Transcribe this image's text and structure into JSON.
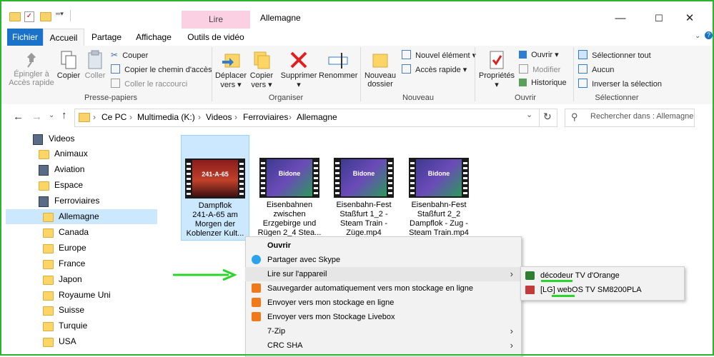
{
  "window": {
    "title": "Allemagne",
    "context_tab": "Lire",
    "controls": [
      "—",
      "☐",
      "✕"
    ]
  },
  "ribbon_tabs": [
    "Fichier",
    "Accueil",
    "Partage",
    "Affichage",
    "Outils de vidéo"
  ],
  "ribbon": {
    "presse": {
      "group": "Presse-papiers",
      "pin": [
        "Épingler à",
        "Accès rapide"
      ],
      "copy": "Copier",
      "paste": "Coller",
      "cut": "Couper",
      "copy_path": "Copier le chemin d'accès",
      "paste_shortcut": "Coller le raccourci"
    },
    "organiser": {
      "group": "Organiser",
      "move": [
        "Déplacer",
        "vers"
      ],
      "copy_to": [
        "Copier",
        "vers"
      ],
      "delete": "Supprimer",
      "rename": "Renommer"
    },
    "nouveau": {
      "group": "Nouveau",
      "new_folder": [
        "Nouveau",
        "dossier"
      ],
      "new_item": "Nouvel élément",
      "easy_access": "Accès rapide"
    },
    "ouvrir": {
      "group": "Ouvrir",
      "properties": "Propriétés",
      "open": "Ouvrir",
      "edit": "Modifier",
      "history": "Historique"
    },
    "selection": {
      "group": "Sélectionner",
      "select_all": "Sélectionner tout",
      "select_none": "Aucun",
      "invert": "Inverser la sélection"
    }
  },
  "address": {
    "crumbs": [
      "Ce PC",
      "Multimedia (K:)",
      "Videos",
      "Ferroviaires",
      "Allemagne"
    ],
    "search_placeholder": "Rechercher dans : Allemagne"
  },
  "tree": [
    {
      "label": "Videos",
      "type": "film"
    },
    {
      "label": "Animaux",
      "type": "folder"
    },
    {
      "label": "Aviation",
      "type": "film"
    },
    {
      "label": "Espace",
      "type": "folder"
    },
    {
      "label": "Ferroviaires",
      "type": "film"
    },
    {
      "label": "Allemagne",
      "type": "folder",
      "selected": true
    },
    {
      "label": "Canada",
      "type": "folder"
    },
    {
      "label": "Europe",
      "type": "folder"
    },
    {
      "label": "France",
      "type": "folder"
    },
    {
      "label": "Japon",
      "type": "folder"
    },
    {
      "label": "Royaume Uni",
      "type": "folder"
    },
    {
      "label": "Suisse",
      "type": "folder"
    },
    {
      "label": "Turquie",
      "type": "folder"
    },
    {
      "label": "USA",
      "type": "folder"
    }
  ],
  "files": [
    {
      "lines": [
        "Dampflok",
        "241-A-65 am",
        "Morgen der",
        "Koblenzer Kult..."
      ],
      "overlay": "241-A-65",
      "selected": true
    },
    {
      "lines": [
        "Eisenbahnen",
        "zwischen",
        "Erzgebirge und",
        "Rügen 2_4 Stea..."
      ],
      "overlay": "Bidone"
    },
    {
      "lines": [
        "Eisenbahn-Fest",
        "Staßfurt 1_2 -",
        "Steam Train -",
        "Züge.mp4"
      ],
      "overlay": "Bidone"
    },
    {
      "lines": [
        "Eisenbahn-Fest",
        "Staßfurt 2_2",
        "Dampflok - Zug -",
        "Steam Train.mp4"
      ],
      "overlay": "Bidone"
    }
  ],
  "context_menu": [
    {
      "label": "Ouvrir",
      "bold": true
    },
    {
      "label": "Partager avec Skype",
      "icon": "skype-icon"
    },
    {
      "label": "Lire sur l'appareil",
      "submenu": true,
      "highlight": true
    },
    {
      "label": "Sauvegarder automatiquement vers mon stockage en ligne",
      "icon": "cloud-backup-icon"
    },
    {
      "label": "Envoyer vers mon stockage en ligne",
      "icon": "cloud-upload-icon"
    },
    {
      "label": "Envoyer vers mon Stockage Livebox",
      "icon": "livebox-icon"
    },
    {
      "label": "7-Zip",
      "submenu": true
    },
    {
      "label": "CRC SHA",
      "submenu": true
    }
  ],
  "submenu": [
    {
      "label": "décodeur TV d'Orange",
      "icon": "decoder-icon"
    },
    {
      "label": "[LG] webOS TV SM8200PLA",
      "icon": "tv-icon"
    }
  ],
  "colors": {
    "accent": "#1a73c8",
    "annotation": "#2bd42b",
    "selection": "#cce8ff"
  }
}
